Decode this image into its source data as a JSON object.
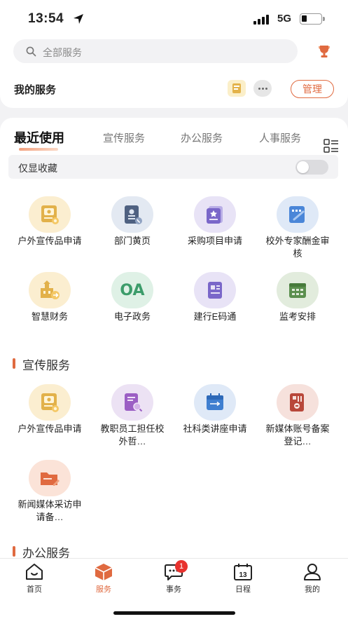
{
  "status": {
    "time": "13:54",
    "network": "5G"
  },
  "search": {
    "placeholder": "全部服务"
  },
  "my_services": {
    "title": "我的服务",
    "manage_label": "管理"
  },
  "tabs": [
    {
      "label": "最近使用",
      "active": true
    },
    {
      "label": "宣传服务",
      "active": false
    },
    {
      "label": "办公服务",
      "active": false
    },
    {
      "label": "人事服务",
      "active": false
    }
  ],
  "filter": {
    "label": "仅显收藏",
    "enabled": false
  },
  "recent": [
    {
      "label": "户外宣传品申请",
      "icon": "promo-certificate-icon"
    },
    {
      "label": "部门黄页",
      "icon": "contacts-book-icon"
    },
    {
      "label": "采购项目申请",
      "icon": "purchase-document-icon"
    },
    {
      "label": "校外专家酬金审核",
      "icon": "approval-form-icon"
    },
    {
      "label": "智慧财务",
      "icon": "finance-building-icon"
    },
    {
      "label": "电子政务",
      "icon": "oa-text-icon",
      "text": "OA"
    },
    {
      "label": "建行E码通",
      "icon": "id-card-icon"
    },
    {
      "label": "监考安排",
      "icon": "calendar-grid-icon"
    }
  ],
  "sections": {
    "promo": {
      "title": "宣传服务",
      "items": [
        {
          "label": "户外宣传品申请",
          "icon": "promo-certificate-icon"
        },
        {
          "label": "教职员工担任校外哲…",
          "icon": "document-search-icon"
        },
        {
          "label": "社科类讲座申请",
          "icon": "lecture-calendar-icon"
        },
        {
          "label": "新媒体账号备案登记…",
          "icon": "media-account-icon"
        },
        {
          "label": "新闻媒体采访申请备…",
          "icon": "folder-edit-icon"
        }
      ]
    },
    "office": {
      "title": "办公服务"
    }
  },
  "bottom_nav": [
    {
      "label": "首页",
      "icon": "home-icon"
    },
    {
      "label": "服务",
      "icon": "service-cube-icon",
      "active": true
    },
    {
      "label": "事务",
      "icon": "chat-bubble-icon",
      "badge": "1"
    },
    {
      "label": "日程",
      "icon": "calendar-icon",
      "day": "13"
    },
    {
      "label": "我的",
      "icon": "profile-icon"
    }
  ],
  "colors": {
    "accent": "#e06a40",
    "badge": "#e8322e",
    "oa_green": "#3c9c6a"
  }
}
